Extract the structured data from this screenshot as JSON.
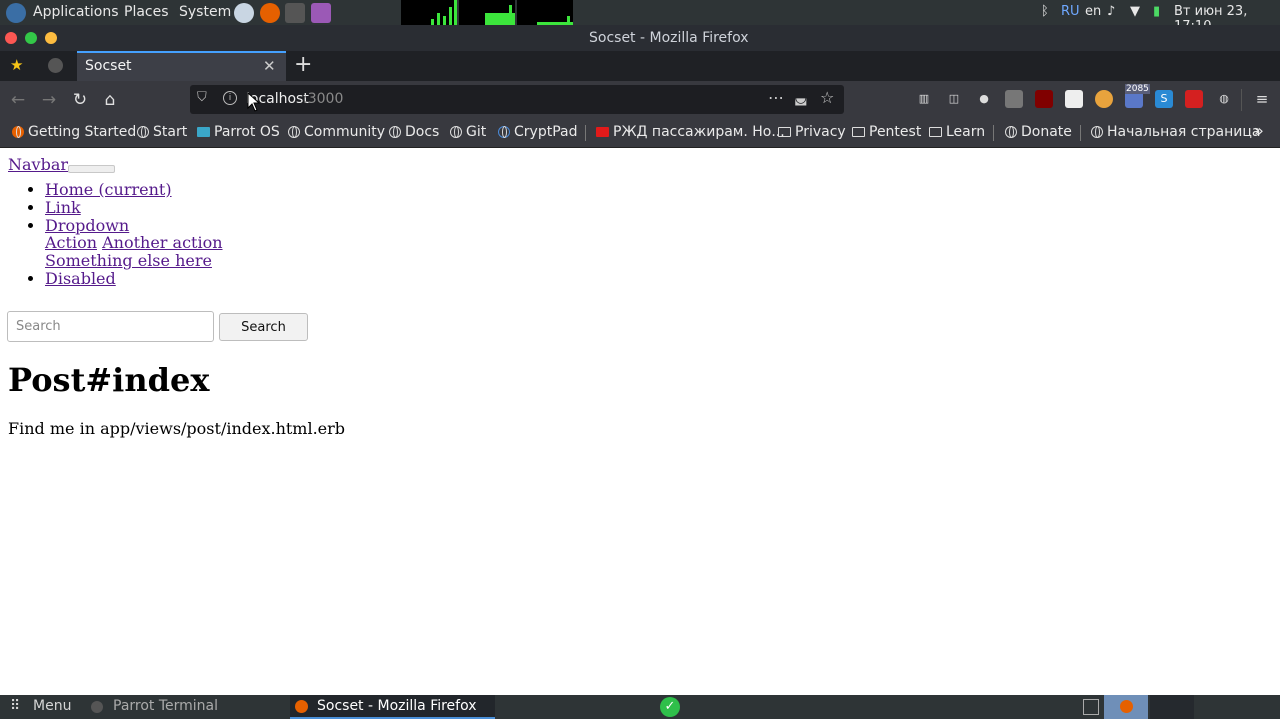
{
  "system_panel": {
    "menus": [
      "Applications",
      "Places",
      "System"
    ],
    "tray": {
      "lang_ru": "RU",
      "lang_en": "en",
      "datetime": "Вт июн 23, 17:10"
    }
  },
  "window": {
    "title": "Socset - Mozilla Firefox"
  },
  "tab": {
    "label": "Socset"
  },
  "urlbar": {
    "host": "localhost",
    "port": ":3000"
  },
  "toolbar": {
    "badge_count": "2085"
  },
  "bookmarks": [
    "Getting Started",
    "Start",
    "Parrot OS",
    "Community",
    "Docs",
    "Git",
    "CryptPad",
    "РЖД пассажирам. Но...",
    "Privacy",
    "Pentest",
    "Learn",
    "Donate",
    "Начальная страница"
  ],
  "page": {
    "brand": "Navbar",
    "nav": {
      "home": "Home (current)",
      "link": "Link",
      "dropdown": "Dropdown",
      "action": "Action",
      "another_action": "Another action",
      "something_else": "Something else here",
      "disabled": "Disabled"
    },
    "search": {
      "placeholder": "Search",
      "button": "Search"
    },
    "heading": "Post#index",
    "body": "Find me in app/views/post/index.html.erb"
  },
  "taskbar": {
    "menu": "Menu",
    "tasks": [
      "Parrot Terminal",
      "Socset - Mozilla Firefox"
    ]
  },
  "colors": {
    "accent": "#45a1ff",
    "link": "#551a8b",
    "panel": "#2e3436"
  }
}
